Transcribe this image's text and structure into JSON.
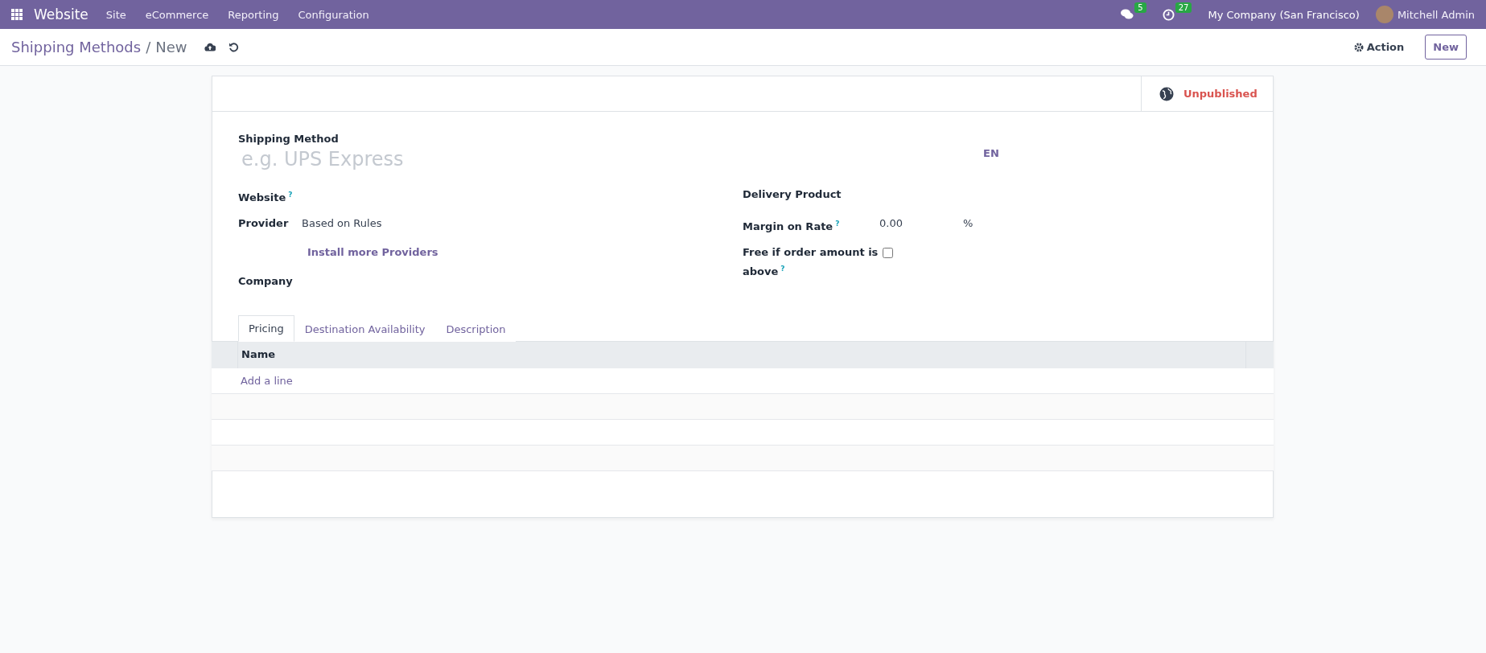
{
  "navbar": {
    "app_name": "Website",
    "menu": [
      "Site",
      "eCommerce",
      "Reporting",
      "Configuration"
    ],
    "messages_count": "5",
    "activities_count": "27",
    "company": "My Company (San Francisco)",
    "user": "Mitchell Admin"
  },
  "control_panel": {
    "breadcrumb_parent": "Shipping Methods",
    "breadcrumb_separator": "/",
    "breadcrumb_current": "New",
    "action": "Action",
    "new_button": "New"
  },
  "status": {
    "label": "Unpublished",
    "published": false
  },
  "title_field": {
    "label": "Shipping Method",
    "placeholder": "e.g. UPS Express",
    "lang": "EN"
  },
  "left_fields": [
    {
      "kind": "empty",
      "label": "Website",
      "help": "?"
    },
    {
      "kind": "text",
      "label": "Provider",
      "value": "Based on Rules",
      "link": "Install more Providers"
    },
    {
      "kind": "empty",
      "label": "Company"
    }
  ],
  "right_fields": [
    {
      "kind": "empty",
      "label": "Delivery Product"
    },
    {
      "kind": "number",
      "label": "Margin on Rate",
      "help": "?",
      "value": "0.00",
      "unit": "%"
    },
    {
      "kind": "checkbox",
      "label": "Free if order amount is above",
      "help": "?",
      "checked": false
    }
  ],
  "tabs": [
    {
      "label": "Pricing",
      "selected": true
    },
    {
      "label": "Destination Availability",
      "selected": false
    },
    {
      "label": "Description",
      "selected": false
    }
  ],
  "table": {
    "columns": [
      "Name"
    ],
    "add_line": "Add a line"
  }
}
